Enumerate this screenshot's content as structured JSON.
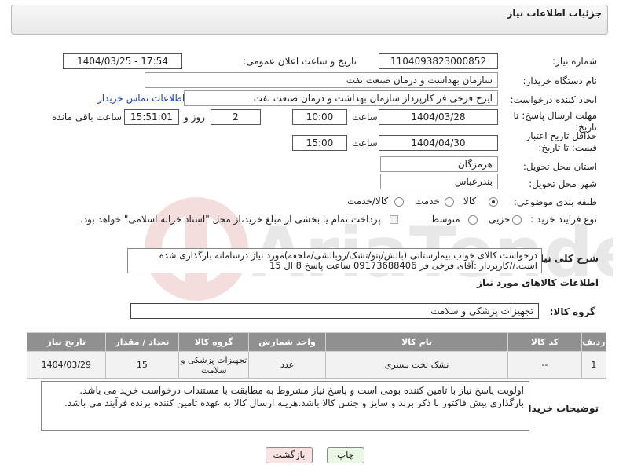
{
  "header": {
    "title": "جزئیات اطلاعات نیاز"
  },
  "fields": {
    "need_number_label": "شماره نیاز:",
    "need_number": "1104093823000852",
    "announce_datetime_label": "تاریخ و ساعت اعلان عمومی:",
    "announce_datetime": "1404/03/25 - 17:54",
    "buyer_org_label": "نام دستگاه خریدار:",
    "buyer_org": "سازمان بهداشت و درمان صنعت نفت",
    "requester_label": "ایجاد کننده درخواست:",
    "requester": "ایرج فرخی فر کارپرداز  سازمان بهداشت و درمان صنعت نفت",
    "buyer_contact_link": "اطلاعات تماس خریدار",
    "reply_deadline_label": "مهلت ارسال پاسخ: تا تاریخ:",
    "reply_date": "1404/03/28",
    "time_label": "ساعت",
    "reply_time": "10:00",
    "days_value": "2",
    "days_label": "روز و",
    "remaining_time": "15:51:01",
    "remaining_label": "ساعت باقی مانده",
    "price_validity_label": "حداقل تاریخ اعتبار قیمت: تا تاریخ:",
    "validity_date": "1404/04/30",
    "validity_time": "15:00",
    "province_label": "استان محل تحویل:",
    "province": "هرمزگان",
    "city_label": "شهر محل تحویل:",
    "city": "بندرعباس",
    "category_label": "طبقه بندی موضوعی:",
    "category_options": [
      "کالا",
      "خدمت",
      "کالا/خدمت"
    ],
    "process_label": "نوع فرآیند خرید :",
    "process_options": [
      "جزیی",
      "متوسط"
    ],
    "payment_note": "پرداخت تمام یا بخشی از مبلغ خرید،از محل \"اسناد خزانه اسلامی\" خواهد بود."
  },
  "description": {
    "label": "شرح کلی نیاز:",
    "text": "درخواست کالای خواب بیمارستانی (بالش/پتو/تشک/روبالشی/ملحفه)مورد نیاز درسامانه بارگذاری شده است.//کارپرداز :آقای فرخی فر 09173688406 ساعت پاسخ 8 ال 15"
  },
  "goods_info": {
    "heading": "اطلاعات کالاهای مورد نیاز",
    "group_label": "گروه کالا:",
    "group_value": "تجهیزات پزشکی و سلامت"
  },
  "table": {
    "headers": [
      "ردیف",
      "کد کالا",
      "نام کالا",
      "واحد شمارش",
      "گروه کالا",
      "تعداد / مقدار",
      "تاریخ نیاز"
    ],
    "rows": [
      [
        "1",
        "--",
        "تشک تخت بستری",
        "عدد",
        "تجهیزات پزشکی و سلامت",
        "15",
        "1404/03/29"
      ]
    ]
  },
  "buyer_notes": {
    "label": "توضیحات خریدار:",
    "text": "اولویت پاسخ نیاز با تامین کننده بومی است و پاسخ نیاز مشروط به مطابقت با مستندات درخواست خرید می باشد. بارگذاری پیش فاکتور با ذکر برند و سایز و جنس کالا باشد.هزینه ارسال کالا به عهده تامین کننده برنده فرآیند می باشد."
  },
  "buttons": {
    "print": "چاپ",
    "back": "بازگشت"
  },
  "watermark": {
    "text": "AriaTender.net"
  },
  "colors": {
    "table_header": "#909090",
    "link": "#1a3fbf",
    "print_btn": "#eaf7e4",
    "back_btn": "#fbe3e3"
  }
}
